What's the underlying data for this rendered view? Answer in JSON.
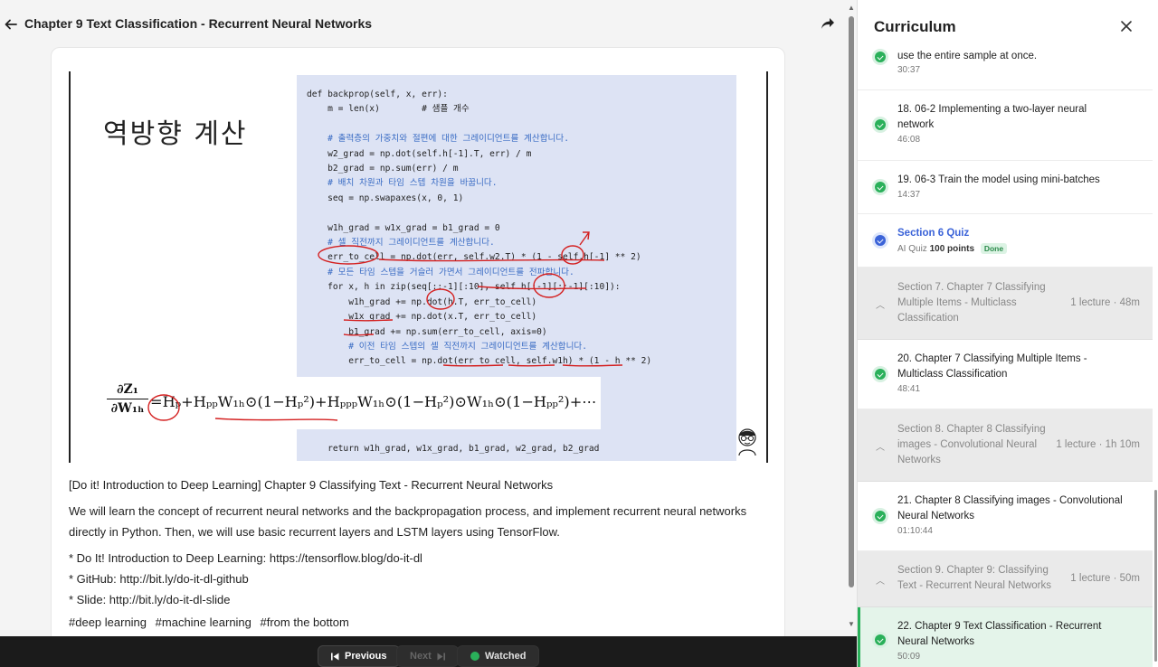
{
  "header": {
    "title": "Chapter 9 Text Classification - Recurrent Neural Networks"
  },
  "slide": {
    "title_kr": "역방향 계산",
    "code_lines": [
      {
        "text": "def backprop(self, x, err):",
        "comment": false
      },
      {
        "text": "    m = len(x)        # 샘플 개수",
        "comment": false
      },
      {
        "text": "",
        "comment": false
      },
      {
        "text": "    # 출력층의 가중치와 절편에 대한 그레이디언트를 계산합니다.",
        "comment": true
      },
      {
        "text": "    w2_grad = np.dot(self.h[-1].T, err) / m",
        "comment": false
      },
      {
        "text": "    b2_grad = np.sum(err) / m",
        "comment": false
      },
      {
        "text": "    # 배치 차원과 타임 스텝 차원을 바꿉니다.",
        "comment": true
      },
      {
        "text": "    seq = np.swapaxes(x, 0, 1)",
        "comment": false
      },
      {
        "text": "",
        "comment": false
      },
      {
        "text": "    w1h_grad = w1x_grad = b1_grad = 0",
        "comment": false
      },
      {
        "text": "    # 셀 직전까지 그레이디언트를 계산합니다.",
        "comment": true
      },
      {
        "text": "    err_to_cell = np.dot(err, self.w2.T) * (1 - self.h[-1] ** 2)",
        "comment": false
      },
      {
        "text": "    # 모든 타임 스텝을 거슬러 가면서 그레이디언트를 전파합니다.",
        "comment": true
      },
      {
        "text": "    for x, h in zip(seq[::-1][:10], self.h[:-1][::-1][:10]):",
        "comment": false
      },
      {
        "text": "        w1h_grad += np.dot(h.T, err_to_cell)",
        "comment": false
      },
      {
        "text": "        w1x_grad += np.dot(x.T, err_to_cell)",
        "comment": false
      },
      {
        "text": "        b1_grad += np.sum(err_to_cell, axis=0)",
        "comment": false
      },
      {
        "text": "        # 이전 타임 스텝의 셀 직전까지 그레이디언트를 계산합니다.",
        "comment": true
      },
      {
        "text": "        err_to_cell = np.dot(err_to_cell, self.w1h) * (1 - h ** 2)",
        "comment": false
      }
    ],
    "return_line": "    return w1h_grad, w1x_grad, b1_grad, w2_grad, b2_grad",
    "formula_num": "∂Z₁",
    "formula_den": "∂W₁ₕ",
    "formula_expr": "=Hₚ+HₚₚW₁ₕ⊙(1−Hₚ²)+HₚₚₚW₁ₕ⊙(1−Hₚ²)⊙W₁ₕ⊙(1−Hₚₚ²)+⋯"
  },
  "description": {
    "heading": "[Do it! Introduction to Deep Learning] Chapter 9 Classifying Text - Recurrent Neural Networks",
    "body": "We will learn the concept of recurrent neural networks and the backpropagation process, and implement recurrent neural networks directly in Python. Then, we will use basic recurrent layers and LSTM layers using TensorFlow.",
    "links": [
      "* Do It! Introduction to Deep Learning: https://tensorflow.blog/do-it-dl",
      "* GitHub: http://bit.ly/do-it-dl-github",
      "* Slide: http://bit.ly/do-it-dl-slide"
    ],
    "tags": [
      "#deep learning",
      "#machine learning",
      "#from the bottom"
    ]
  },
  "bottombar": {
    "previous": "Previous",
    "next": "Next",
    "watched": "Watched"
  },
  "sidebar": {
    "title": "Curriculum",
    "items": [
      {
        "kind": "lecture",
        "title": "use the entire sample at once.",
        "duration": "30:37"
      },
      {
        "kind": "lecture",
        "title": "18. 06-2 Implementing a two-layer neural network",
        "duration": "46:08"
      },
      {
        "kind": "lecture",
        "title": "19. 06-3 Train the model using mini-batches",
        "duration": "14:37"
      },
      {
        "kind": "quiz",
        "title": "Section 6 Quiz",
        "sub_label": "AI Quiz",
        "points": "100 points",
        "badge": "Done"
      },
      {
        "kind": "section",
        "title": "Section 7. Chapter 7 Classifying Multiple Items - Multiclass Classification",
        "meta": "1 lecture · 48m"
      },
      {
        "kind": "lecture",
        "title": "20. Chapter 7 Classifying Multiple Items - Multiclass Classification",
        "duration": "48:41"
      },
      {
        "kind": "section",
        "title": "Section 8. Chapter 8 Classifying images - Convolutional Neural Networks",
        "meta": "1 lecture · 1h 10m"
      },
      {
        "kind": "lecture",
        "title": "21. Chapter 8 Classifying images - Convolutional Neural Networks",
        "duration": "01:10:44"
      },
      {
        "kind": "section",
        "title": "Section 9. Chapter 9: Classifying Text - Recurrent Neural Networks",
        "meta": "1 lecture · 50m"
      },
      {
        "kind": "lecture",
        "title": "22. Chapter 9 Text Classification - Recurrent Neural Networks",
        "duration": "50:09",
        "active": true
      }
    ]
  },
  "colors": {
    "accent_green": "#2ab05a",
    "accent_blue": "#3b63d8",
    "annotation_red": "#d42020"
  }
}
